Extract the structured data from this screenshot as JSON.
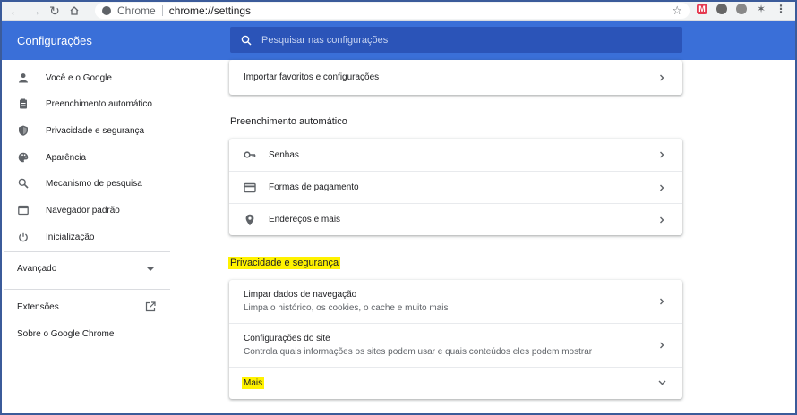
{
  "browser": {
    "site_name": "Chrome",
    "url": "chrome://settings"
  },
  "header": {
    "title": "Configurações",
    "search_placeholder": "Pesquisar nas configurações"
  },
  "sidebar": {
    "items": [
      {
        "label": "Você e o Google",
        "icon": "person-icon"
      },
      {
        "label": "Preenchimento automático",
        "icon": "clipboard-icon"
      },
      {
        "label": "Privacidade e segurança",
        "icon": "shield-icon"
      },
      {
        "label": "Aparência",
        "icon": "palette-icon"
      },
      {
        "label": "Mecanismo de pesquisa",
        "icon": "search-icon"
      },
      {
        "label": "Navegador padrão",
        "icon": "browser-window-icon"
      },
      {
        "label": "Inicialização",
        "icon": "power-icon"
      }
    ],
    "advanced_label": "Avançado",
    "extensions_label": "Extensões",
    "about_label": "Sobre o Google Chrome"
  },
  "main": {
    "import_card": {
      "label": "Importar favoritos e configurações"
    },
    "autofill_section": {
      "title": "Preenchimento automático",
      "rows": [
        {
          "label": "Senhas",
          "icon": "key-icon"
        },
        {
          "label": "Formas de pagamento",
          "icon": "credit-card-icon"
        },
        {
          "label": "Endereços e mais",
          "icon": "location-pin-icon"
        }
      ]
    },
    "privacy_section": {
      "title": "Privacidade e segurança",
      "rows": [
        {
          "label": "Limpar dados de navegação",
          "sublabel": "Limpa o histórico, os cookies, o cache e muito mais"
        },
        {
          "label": "Configurações do site",
          "sublabel": "Controla quais informações os sites podem usar e quais conteúdos eles podem mostrar"
        }
      ],
      "more_label": "Mais"
    }
  },
  "colors": {
    "header_bg": "#3a6fd8",
    "search_bg": "#2b54b8",
    "highlight": "#fff200",
    "frame_border": "#3b5b9a"
  }
}
